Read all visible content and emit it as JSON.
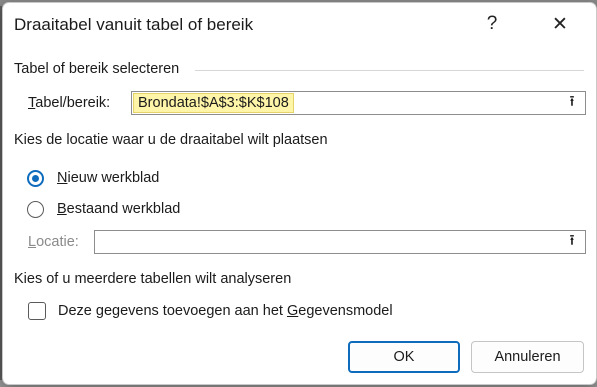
{
  "dialog": {
    "title": "Draaitabel vanuit tabel of bereik",
    "help_glyph": "?",
    "close_glyph": "✕"
  },
  "section_select": {
    "heading": "Tabel of bereik selecteren",
    "range_label_prefix": "T",
    "range_label_rest": "abel/bereik:",
    "range_value": "Brondata!$A$3:$K$108",
    "collapse_glyph": "⭱"
  },
  "section_location": {
    "heading": "Kies de locatie waar u de draaitabel wilt plaatsen",
    "options": [
      {
        "accel": "N",
        "rest": "ieuw werkblad",
        "checked": true
      },
      {
        "accel": "B",
        "rest": "estaand werkblad",
        "checked": false
      }
    ],
    "location_label_prefix": "L",
    "location_label_rest": "ocatie:",
    "location_value": "",
    "collapse_glyph": "⭱"
  },
  "section_analyze": {
    "heading": "Kies of u meerdere tabellen wilt analyseren",
    "checkbox_before": "Deze gegevens toevoegen aan het ",
    "checkbox_accel": "G",
    "checkbox_after": "egevensmodel",
    "checked": false
  },
  "buttons": {
    "ok": "OK",
    "cancel": "Annuleren"
  },
  "colors": {
    "accent": "#0f6cbd",
    "highlight": "#fff5a8"
  }
}
